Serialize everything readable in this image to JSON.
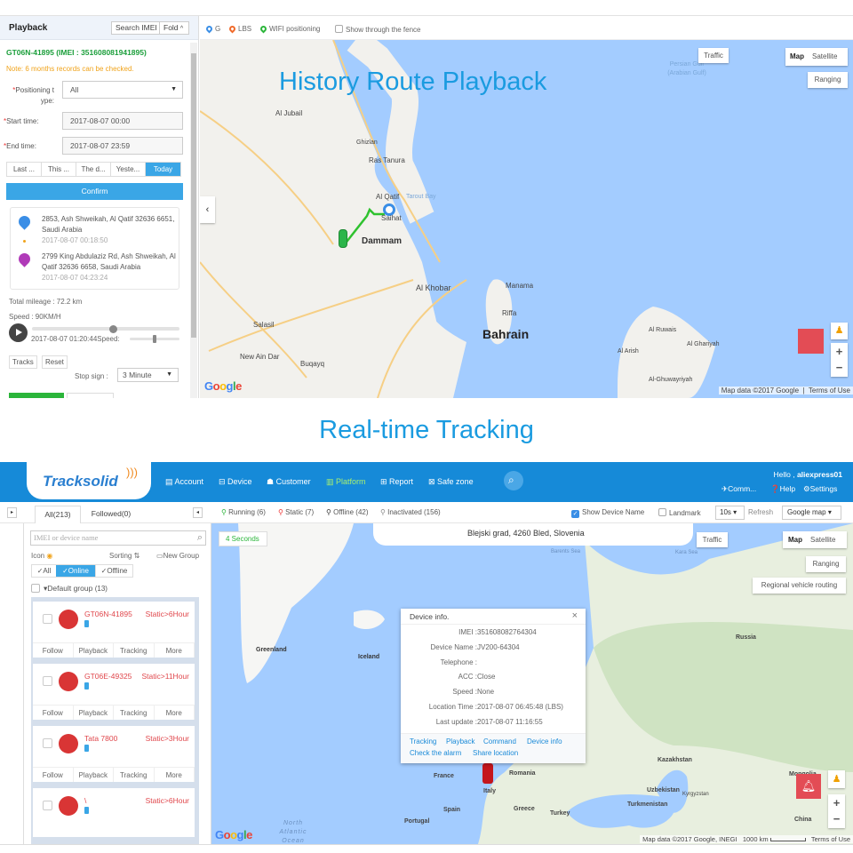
{
  "playback_panel": {
    "title": "Playback",
    "search_imei_label": "Search IMEI",
    "fold_label": "Fold",
    "device_header": "GT06N-41895  (IMEI : 351608081941895)",
    "note": "Note: 6 months records can be checked.",
    "positioning_type_label_1": "Positioning t",
    "positioning_type_label_2": "ype:",
    "positioning_type_value": "All",
    "start_time_label": "Start time:",
    "start_time_value": "2017-08-07 00:00",
    "end_time_label": "End time:",
    "end_time_value": "2017-08-07 23:59",
    "quick_ranges": [
      "Last ...",
      "This ...",
      "The d...",
      "Yeste...",
      "Today"
    ],
    "confirm_label": "Confirm",
    "start_address": "2853, Ash Shweikah, Al Qatif 32636 6651, Saudi Arabia",
    "start_time": "2017-08-07 00:18:50",
    "end_address": "2799 King Abdulaziz Rd, Ash Shweikah, Al Qatif 32636 6658, Saudi Arabia",
    "end_time": "2017-08-07 04:23:24",
    "total_mileage": "Total mileage : 72.2 km",
    "speed": "Speed : 90KM/H",
    "current_time": "2017-08-07 01:20:44",
    "speed_label": "Speed:",
    "progress_fraction": 0.55,
    "speed_fraction": 0.5,
    "tracks_label": "Tracks",
    "reset_label": "Reset",
    "stop_sign_label": "Stop sign :",
    "stop_sign_value": "3 Minute"
  },
  "playback_map": {
    "legend": [
      {
        "label": "G",
        "color": "#3a8ee6"
      },
      {
        "label": "LBS",
        "color": "#f06a2a"
      },
      {
        "label": "WIFI positioning",
        "color": "#2bb53a"
      }
    ],
    "fence_label": "Show through the fence",
    "overlay_title": "History Route Playback",
    "traffic_label": "Traffic",
    "map_label": "Map",
    "satellite_label": "Satellite",
    "ranging_label": "Ranging",
    "places": [
      "Al Jubail",
      "Ghizlan",
      "Ras Tanura",
      "Al Qatif",
      "Tarout Bay",
      "Saihat",
      "Dammam",
      "Al Khobar",
      "Manama",
      "Riffa",
      "Bahrain",
      "Salasil",
      "New Ain Dar",
      "Buqayq",
      "Al Ruwais",
      "Al Ghariyah",
      "Al Arish",
      "Al-Ghuwayriyah",
      "Persian Gulf (Arabian Gulf)"
    ],
    "attribution": "Map data ©2017 Google",
    "terms": "Terms of Use",
    "google": "Google"
  },
  "section_title": "Real-time Tracking",
  "tracksolid": {
    "logo": "Tracksolid",
    "nav": [
      {
        "label": "Account",
        "icon": "account-icon"
      },
      {
        "label": "Device",
        "icon": "device-icon"
      },
      {
        "label": "Customer",
        "icon": "customer-icon"
      },
      {
        "label": "Platform",
        "icon": "platform-icon",
        "active": true
      },
      {
        "label": "Report",
        "icon": "report-icon"
      },
      {
        "label": "Safe zone",
        "icon": "safe-zone-icon"
      }
    ],
    "greeting": "Hello ,",
    "username": "aliexpress01",
    "comm_label": "Comm...",
    "help_label": "Help",
    "settings_label": "Settings",
    "tabs": [
      "All(213)",
      "Followed(0)"
    ],
    "statuses": [
      {
        "label": "Running (6)",
        "color": "#2bb53a"
      },
      {
        "label": "Static (7)",
        "color": "#e33"
      },
      {
        "label": "Offline (42)",
        "color": "#555"
      },
      {
        "label": "Inactivated (156)",
        "color": "#888"
      }
    ],
    "show_device_name": "Show Device Name",
    "landmark": "Landmark",
    "refresh_interval": "10s",
    "refresh_label": "Refresh",
    "map_type": "Google map",
    "search_placeholder": "IMEI or device name",
    "icon_label": "Icon",
    "sorting_label": "Sorting",
    "new_group_label": "New Group",
    "filters": [
      "All",
      "Online",
      "Offline"
    ],
    "group_label": "Default group",
    "group_count": "(13)",
    "devices": [
      {
        "name": "GT06N-41895",
        "status": "Static>6Hour"
      },
      {
        "name": "GT06E-49325",
        "status": "Static>11Hour"
      },
      {
        "name": "Tata 7800",
        "status": "Static>3Hour"
      },
      {
        "name": "\\",
        "status": "Static>6Hour"
      }
    ],
    "device_actions": [
      "Follow",
      "Playback",
      "Tracking",
      "More"
    ],
    "countdown": "4 Seconds",
    "address": "Blejski grad, 4260 Bled, Slovenia",
    "traffic_label": "Traffic",
    "map_label": "Map",
    "satellite_label": "Satellite",
    "ranging_label": "Ranging",
    "regional_label": "Regional vehicle routing",
    "popup": {
      "title": "Device info.",
      "rows": [
        {
          "k": "IMEI :",
          "v": "351608082764304"
        },
        {
          "k": "Device Name :",
          "v": "JV200-64304"
        },
        {
          "k": "Telephone :",
          "v": ""
        },
        {
          "k": "ACC :",
          "v": "Close"
        },
        {
          "k": "Speed :",
          "v": "None"
        },
        {
          "k": "Location Time :",
          "v": "2017-08-07 06:45:48 (LBS)"
        },
        {
          "k": "Last update :",
          "v": "2017-08-07 11:16:55"
        }
      ],
      "links": [
        "Tracking",
        "Playback",
        "Command",
        "Device info",
        "Check the alarm",
        "Share location"
      ]
    },
    "places": [
      "Greenland",
      "Iceland",
      "Russia",
      "France",
      "Spain",
      "Portugal",
      "Italy",
      "Romania",
      "Greece",
      "Turkey",
      "Kazakhstan",
      "Uzbekistan",
      "Turkmenistan",
      "Kyrgyzstan",
      "Mongolia",
      "China",
      "North Atlantic Ocean",
      "Barents Sea",
      "Kara Sea"
    ],
    "attribution": "Map data ©2017 Google, INEGI",
    "scale": "1000 km",
    "terms": "Terms of Use",
    "google": "Google"
  }
}
